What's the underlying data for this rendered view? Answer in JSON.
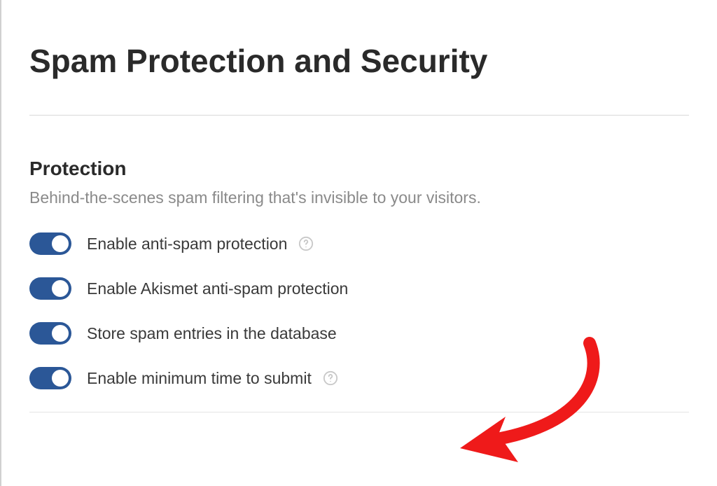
{
  "page": {
    "title": "Spam Protection and Security"
  },
  "section": {
    "title": "Protection",
    "subtitle": "Behind-the-scenes spam filtering that's invisible to your visitors."
  },
  "options": [
    {
      "label": "Enable anti-spam protection",
      "enabled": true,
      "hasHelp": true
    },
    {
      "label": "Enable Akismet anti-spam protection",
      "enabled": true,
      "hasHelp": false
    },
    {
      "label": "Store spam entries in the database",
      "enabled": true,
      "hasHelp": false
    },
    {
      "label": "Enable minimum time to submit",
      "enabled": true,
      "hasHelp": true
    }
  ],
  "colors": {
    "toggleOn": "#2b5797",
    "arrow": "#ef1a1a"
  }
}
